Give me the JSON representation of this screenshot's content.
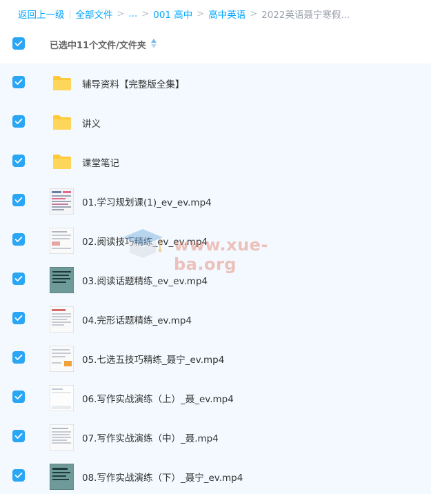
{
  "breadcrumb": {
    "back": "返回上一级",
    "all_files": "全部文件",
    "ellipsis": "...",
    "level1": "001 高中",
    "level2": "高中英语",
    "current": "2022英语聂宁寒假..."
  },
  "header": {
    "selection_text": "已选中11个文件/文件夹"
  },
  "watermark": {
    "text": "www.xue-ba.org"
  },
  "files": [
    {
      "name": "辅导资料【完整版全集】",
      "type": "folder",
      "checked": true
    },
    {
      "name": "讲义",
      "type": "folder",
      "checked": true
    },
    {
      "name": "课堂笔记",
      "type": "folder",
      "checked": true
    },
    {
      "name": "01.学习规划课(1)_ev_ev.mp4",
      "type": "video",
      "checked": true
    },
    {
      "name": "02.阅读技巧精练_ev_ev.mp4",
      "type": "video",
      "checked": true
    },
    {
      "name": "03.阅读话题精练_ev_ev.mp4",
      "type": "video",
      "checked": true
    },
    {
      "name": "04.完形话题精练_ev.mp4",
      "type": "video",
      "checked": true
    },
    {
      "name": "05.七选五技巧精练_聂宁_ev.mp4",
      "type": "video",
      "checked": true
    },
    {
      "name": "06.写作实战演练（上）_聂_ev.mp4",
      "type": "video",
      "checked": true
    },
    {
      "name": "07.写作实战演练（中）_聂.mp4",
      "type": "video",
      "checked": true
    },
    {
      "name": "08.写作实战演练（下）_聂宁_ev.mp4",
      "type": "video",
      "checked": true
    }
  ],
  "colors": {
    "accent": "#06a7ff",
    "checkbox": "#2aa6f5",
    "folder": "#ffd04b",
    "list_bg": "#f3f9fe"
  }
}
